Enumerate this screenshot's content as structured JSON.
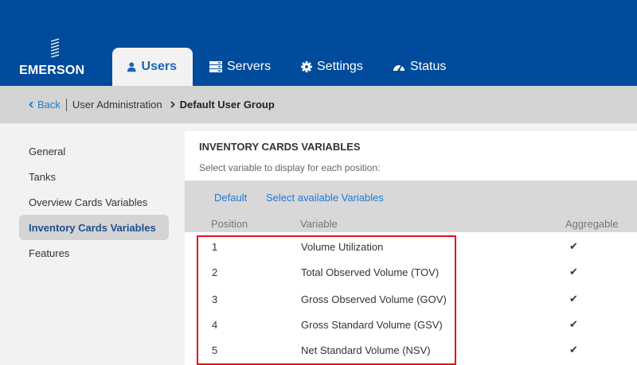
{
  "header": {
    "logo_text": "EMERSON",
    "tabs": [
      {
        "label": "Users",
        "icon": "user-icon",
        "active": true
      },
      {
        "label": "Servers",
        "icon": "server-icon",
        "active": false
      },
      {
        "label": "Settings",
        "icon": "gear-icon",
        "active": false
      },
      {
        "label": "Status",
        "icon": "dashboard-icon",
        "active": false
      }
    ],
    "colors": {
      "bar": "#004b9b",
      "active_tab_text": "#1f63b1"
    }
  },
  "breadcrumb": {
    "back_label": "Back",
    "parent_label": "User Administration",
    "current_label": "Default User Group"
  },
  "sidebar": {
    "items": [
      {
        "label": "General",
        "active": false
      },
      {
        "label": "Tanks",
        "active": false
      },
      {
        "label": "Overview Cards Variables",
        "active": false
      },
      {
        "label": "Inventory Cards Variables",
        "active": true
      },
      {
        "label": "Features",
        "active": false
      }
    ]
  },
  "main": {
    "title": "INVENTORY CARDS VARIABLES",
    "subtitle": "Select variable to display for each position:",
    "tabs": [
      "Default",
      "Select available Variables"
    ],
    "columns": {
      "position": "Position",
      "variable": "Variable",
      "aggregable": "Aggregable"
    },
    "rows": [
      {
        "position": "1",
        "variable": "Volume Utilization",
        "aggregable": true
      },
      {
        "position": "2",
        "variable": "Total Observed Volume (TOV)",
        "aggregable": true
      },
      {
        "position": "3",
        "variable": "Gross Observed Volume (GOV)",
        "aggregable": true
      },
      {
        "position": "4",
        "variable": "Gross Standard Volume (GSV)",
        "aggregable": true
      },
      {
        "position": "5",
        "variable": "Net Standard Volume (NSV)",
        "aggregable": true
      }
    ],
    "check_glyph": "✔",
    "highlight_color": "#e3101b"
  }
}
